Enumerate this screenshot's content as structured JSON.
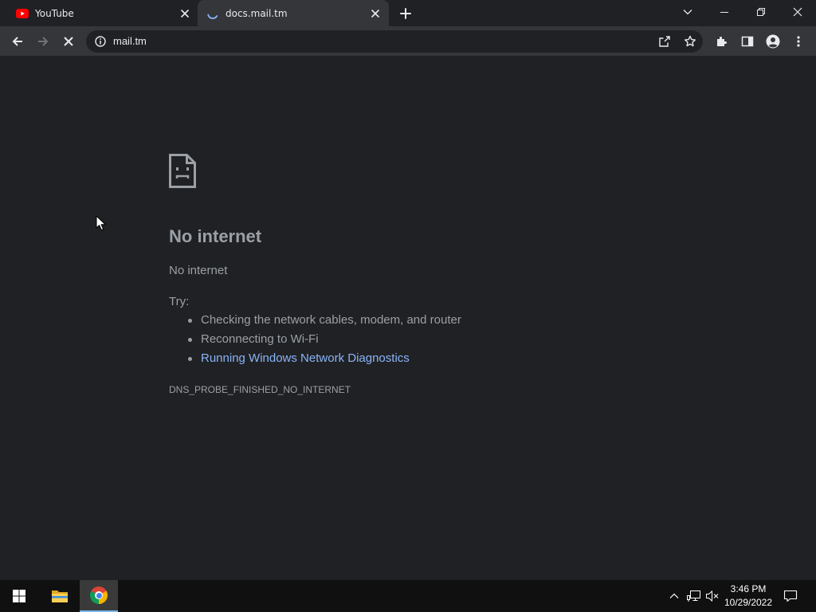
{
  "colors": {
    "frame": "#202124",
    "toolbar": "#35363a",
    "active_tab": "#35363a",
    "omnibox": "#202124",
    "page_background": "#202124",
    "text_primary": "#e8eaed",
    "text_secondary": "#9aa0a6",
    "link": "#8ab4f8",
    "taskbar": "#101010"
  },
  "browser": {
    "tabs": [
      {
        "title": "YouTube",
        "icon": "youtube-icon",
        "active": false,
        "loading": false
      },
      {
        "title": "docs.mail.tm",
        "icon": "loading-spinner-icon",
        "active": true,
        "loading": true
      }
    ],
    "new_tab_icon": "plus-icon",
    "window_controls": {
      "tab_search_icon": "chevron-down-icon",
      "minimize_icon": "minimize-icon",
      "restore_icon": "restore-icon",
      "close_icon": "close-icon"
    },
    "toolbar": {
      "back_icon": "back-arrow-icon",
      "forward_icon": "forward-arrow-icon",
      "forward_enabled": false,
      "stop_icon": "stop-icon",
      "omnibox": {
        "site_info_icon": "info-icon",
        "url": "mail.tm",
        "share_icon": "share-icon",
        "bookmark_icon": "star-icon"
      },
      "extensions_icon": "puzzle-icon",
      "side_panel_icon": "side-panel-icon",
      "profile_icon": "profile-icon",
      "menu_icon": "kebab-menu-icon"
    }
  },
  "page": {
    "icon": "sad-file-icon",
    "heading": "No internet",
    "message": "No internet",
    "try_label": "Try:",
    "suggestions": [
      {
        "text": "Checking the network cables, modem, and router",
        "is_link": false
      },
      {
        "text": "Reconnecting to Wi-Fi",
        "is_link": false
      },
      {
        "text": "Running Windows Network Diagnostics",
        "is_link": true
      }
    ],
    "error_code": "DNS_PROBE_FINISHED_NO_INTERNET"
  },
  "taskbar": {
    "start_icon": "windows-start-icon",
    "pinned_apps": [
      {
        "icon": "file-explorer-icon",
        "active": false
      },
      {
        "icon": "chrome-icon",
        "active": true
      }
    ],
    "tray": {
      "overflow_icon": "chevron-up-icon",
      "network_icon": "ethernet-icon",
      "volume_icon": "speaker-muted-icon",
      "time": "3:46 PM",
      "date": "10/29/2022",
      "notification_icon": "notification-icon"
    }
  },
  "screen": {
    "cursor_icon": "mouse-pointer-icon"
  }
}
